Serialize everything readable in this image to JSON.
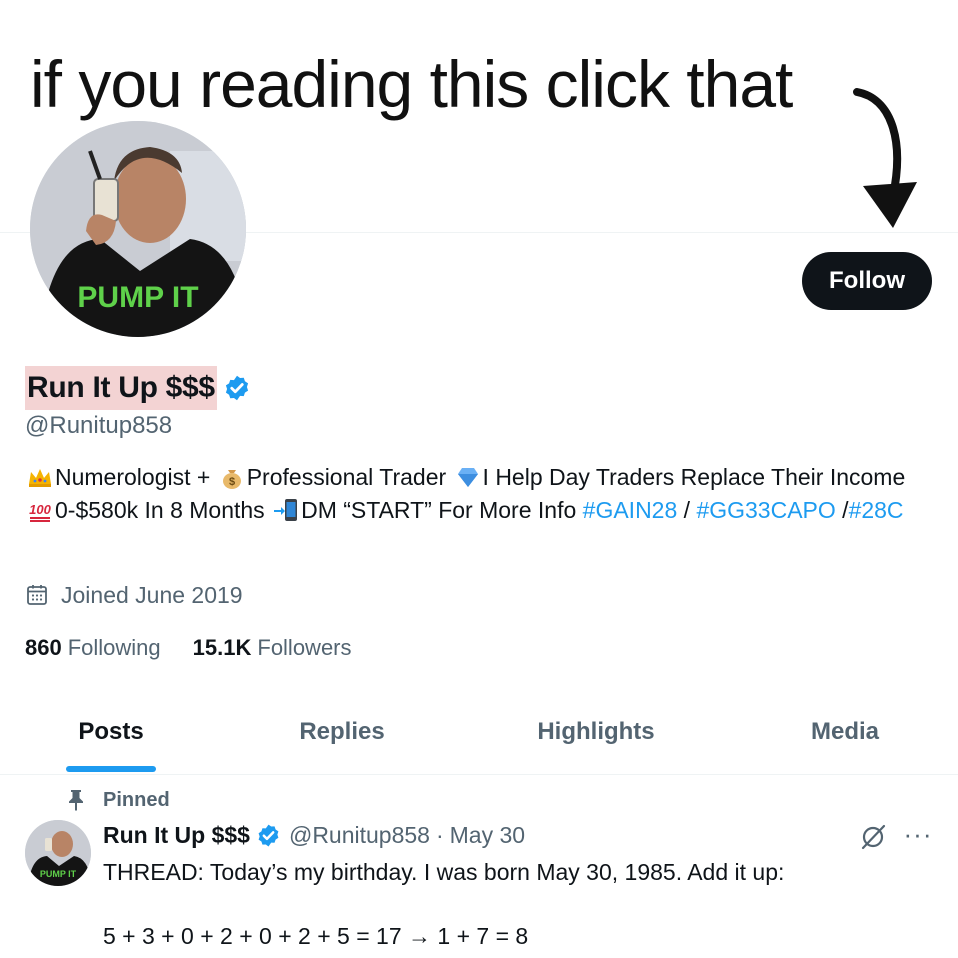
{
  "meme": {
    "caption": "if you reading this click that"
  },
  "profile": {
    "avatar_text": "PUMP IT",
    "follow_label": "Follow",
    "display_name": "Run It Up $$$",
    "handle": "@Runitup858",
    "bio": {
      "seg1": "Numerologist + ",
      "seg2": "Professional Trader ",
      "seg3": "I Help Day Traders Replace Their Income ",
      "seg4": "0-$580k In 8 Months ",
      "seg5": "DM “START” For More Info ",
      "hashtag1": "#GAIN28",
      "sep1": " / ",
      "hashtag2": "#GG33CAPO",
      "sep2": " /",
      "hashtag3": "#28C"
    },
    "joined": "Joined June 2019",
    "following_count": "860",
    "following_label": "Following",
    "followers_count": "15.1K",
    "followers_label": "Followers"
  },
  "tabs": [
    {
      "label": "Posts",
      "active": true
    },
    {
      "label": "Replies",
      "active": false
    },
    {
      "label": "Highlights",
      "active": false
    },
    {
      "label": "Media",
      "active": false
    }
  ],
  "pinned_tweet": {
    "pinned_label": "Pinned",
    "avatar_text": "PUMP IT",
    "name": "Run It Up $$$",
    "handle": "@Runitup858",
    "dot": "·",
    "date": "May 30",
    "more": "···",
    "line1": "THREAD: Today’s my birthday. I was born May 30, 1985. Add it up:",
    "line2": "5 + 3 + 0 + 2 + 0 + 2 + 5 = 17 → 1 + 7 = 8"
  },
  "icons": {
    "verified": "verified-badge-icon",
    "crown": "crown-emoji",
    "money_bag": "money-bag-emoji",
    "gem": "gem-emoji",
    "hundred": "hundred-emoji",
    "phone": "phone-arrow-emoji",
    "calendar": "calendar-icon",
    "pin": "pin-icon",
    "grok": "grok-icon",
    "more": "more-icon",
    "arrow": "curved-arrow-icon"
  },
  "colors": {
    "accent": "#1d9bf0",
    "text": "#0f1419",
    "muted": "#536471",
    "name_highlight": "#f3d3d3",
    "follow_bg": "#0f1419",
    "avatar_text": "#5fd14a"
  }
}
